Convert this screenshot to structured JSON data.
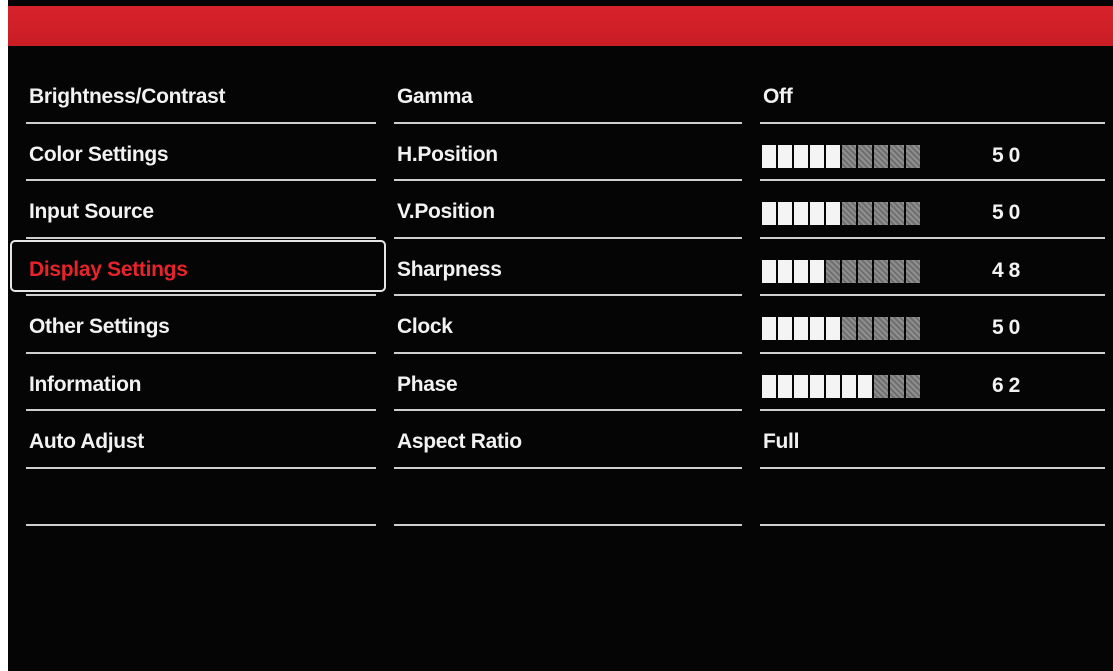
{
  "menu": {
    "items": [
      {
        "label": "Brightness/Contrast"
      },
      {
        "label": "Color Settings"
      },
      {
        "label": "Input Source"
      },
      {
        "label": "Display Settings",
        "selected": true
      },
      {
        "label": "Other Settings"
      },
      {
        "label": "Information"
      },
      {
        "label": "Auto Adjust"
      },
      {
        "label": ""
      }
    ]
  },
  "submenu": {
    "items": [
      {
        "label": "Gamma"
      },
      {
        "label": "H.Position"
      },
      {
        "label": "V.Position"
      },
      {
        "label": "Sharpness"
      },
      {
        "label": "Clock"
      },
      {
        "label": "Phase"
      },
      {
        "label": "Aspect Ratio"
      },
      {
        "label": ""
      }
    ]
  },
  "values": {
    "gamma": "Off",
    "h_position": "50",
    "v_position": "50",
    "sharpness": "48",
    "clock": "50",
    "phase": "62",
    "aspect_ratio": "Full"
  },
  "sliders": {
    "h_position_lit": 5,
    "v_position_lit": 5,
    "sharpness_lit": 4,
    "clock_lit": 5,
    "phase_lit": 7,
    "total_segments": 10
  },
  "colors": {
    "accent_red": "#d8222b",
    "selected_text": "#e8232b",
    "background": "#050505"
  }
}
